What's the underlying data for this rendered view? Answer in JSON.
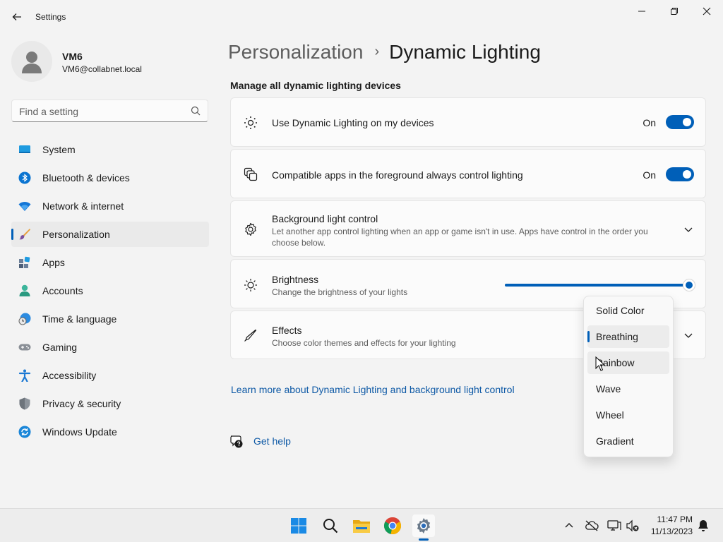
{
  "window": {
    "title": "Settings"
  },
  "user": {
    "name": "VM6",
    "email": "VM6@collabnet.local"
  },
  "search": {
    "placeholder": "Find a setting"
  },
  "sidebar": {
    "items": [
      {
        "label": "System",
        "icon": "system-icon"
      },
      {
        "label": "Bluetooth & devices",
        "icon": "bluetooth-icon"
      },
      {
        "label": "Network & internet",
        "icon": "wifi-icon"
      },
      {
        "label": "Personalization",
        "icon": "brush-icon",
        "active": true
      },
      {
        "label": "Apps",
        "icon": "apps-icon"
      },
      {
        "label": "Accounts",
        "icon": "accounts-icon"
      },
      {
        "label": "Time & language",
        "icon": "clock-globe-icon"
      },
      {
        "label": "Gaming",
        "icon": "gamepad-icon"
      },
      {
        "label": "Accessibility",
        "icon": "accessibility-icon"
      },
      {
        "label": "Privacy & security",
        "icon": "shield-icon"
      },
      {
        "label": "Windows Update",
        "icon": "update-icon"
      }
    ]
  },
  "header": {
    "parent": "Personalization",
    "separator": "›",
    "current": "Dynamic Lighting"
  },
  "main": {
    "section_heading": "Manage all dynamic lighting devices",
    "use_dynamic": {
      "title": "Use Dynamic Lighting on my devices",
      "state": "On",
      "icon": "sun-dots-icon"
    },
    "foreground_apps": {
      "title": "Compatible apps in the foreground always control lighting",
      "state": "On",
      "icon": "layered-apps-icon"
    },
    "background_control": {
      "title": "Background light control",
      "desc": "Let another app control lighting when an app or game isn't in use. Apps have control in the order you choose below.",
      "icon": "gear-icon"
    },
    "brightness": {
      "title": "Brightness",
      "desc": "Change the brightness of your lights",
      "value": 100,
      "icon": "brightness-icon"
    },
    "effects": {
      "title": "Effects",
      "desc": "Choose color themes and effects for your lighting",
      "icon": "pen-icon"
    },
    "learn_more": "Learn more about Dynamic Lighting and background light control",
    "get_help": "Get help"
  },
  "effects_dropdown": {
    "options": [
      "Solid Color",
      "Breathing",
      "Rainbow",
      "Wave",
      "Wheel",
      "Gradient"
    ],
    "selected": "Breathing",
    "hovered": "Rainbow"
  },
  "taskbar": {
    "time": "11:47 PM",
    "date": "11/13/2023"
  },
  "colors": {
    "accent": "#005fb8",
    "link": "#0f5aa6"
  }
}
